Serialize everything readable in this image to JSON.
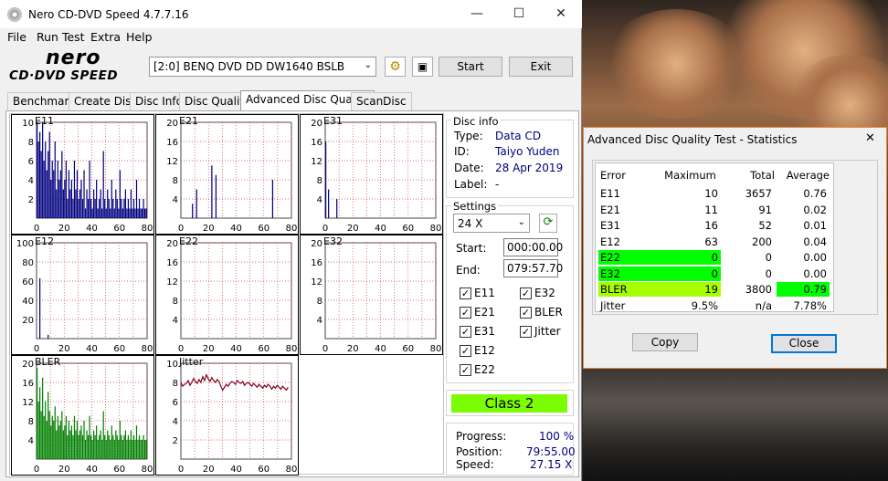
{
  "app": {
    "title": "Nero CD-DVD Speed 4.7.7.16",
    "logo_top": "nero",
    "logo_bottom": "CD·DVD SPEED"
  },
  "window_controls": {
    "minimize": "—",
    "maximize": "☐",
    "close": "✕"
  },
  "menu": [
    "File",
    "Run Test",
    "Extra",
    "Help"
  ],
  "toolbar": {
    "drive": "[2:0]   BENQ DVD DD DW1640 BSLB",
    "start": "Start",
    "exit": "Exit"
  },
  "tabs": [
    "Benchmark",
    "Create Disc",
    "Disc Info",
    "Disc Quality",
    "Advanced Disc Quality",
    "ScanDisc"
  ],
  "active_tab": "Advanced Disc Quality",
  "charts": [
    {
      "label": "E11",
      "yticks": [
        "10",
        "8",
        "6",
        "4",
        "2"
      ],
      "xticks": [
        "0",
        "20",
        "40",
        "60",
        "80"
      ]
    },
    {
      "label": "E21",
      "yticks": [
        "20",
        "16",
        "12",
        "8",
        "4"
      ],
      "xticks": [
        "0",
        "20",
        "40",
        "60",
        "80"
      ]
    },
    {
      "label": "E31",
      "yticks": [
        "20",
        "16",
        "12",
        "8",
        "4"
      ],
      "xticks": [
        "0",
        "20",
        "40",
        "60",
        "80"
      ]
    },
    {
      "label": "E12",
      "yticks": [
        "100",
        "80",
        "60",
        "40",
        "20"
      ],
      "xticks": [
        "0",
        "20",
        "40",
        "60",
        "80"
      ]
    },
    {
      "label": "E22",
      "yticks": [
        "20",
        "16",
        "12",
        "8",
        "4"
      ],
      "xticks": [
        "0",
        "20",
        "40",
        "60",
        "80"
      ]
    },
    {
      "label": "E32",
      "yticks": [
        "20",
        "16",
        "12",
        "8",
        "4"
      ],
      "xticks": [
        "0",
        "20",
        "40",
        "60",
        "80"
      ]
    },
    {
      "label": "BLER",
      "yticks": [
        "20",
        "16",
        "12",
        "8",
        "4"
      ],
      "xticks": [
        "0",
        "20",
        "40",
        "60",
        "80"
      ]
    },
    {
      "label": "Jitter",
      "yticks": [
        "10",
        "8",
        "6",
        "4",
        "2"
      ],
      "xticks": [
        "0",
        "20",
        "40",
        "60",
        "80"
      ]
    }
  ],
  "chart_data": [
    {
      "type": "bar",
      "title": "E11",
      "x": [
        0,
        80
      ],
      "ylim": [
        0,
        10
      ],
      "values": [
        10,
        8,
        9,
        7,
        10,
        6,
        8,
        5,
        7,
        9,
        4,
        6,
        5,
        8,
        3,
        6,
        4,
        5,
        7,
        3,
        4,
        6,
        2,
        5,
        3,
        4,
        2,
        6,
        3,
        5,
        2,
        3,
        4,
        2,
        5,
        1,
        3,
        2,
        6,
        2,
        1,
        3,
        2,
        4,
        1,
        2,
        3,
        1,
        7,
        2,
        1,
        3,
        2,
        1,
        4,
        2,
        1,
        3,
        2,
        1,
        5,
        2,
        1,
        2,
        3,
        1,
        2,
        1,
        3,
        1,
        2,
        1,
        4,
        1,
        2,
        1,
        1,
        2,
        1,
        1
      ]
    },
    {
      "type": "bar",
      "title": "E21",
      "x": [
        0,
        80
      ],
      "ylim": [
        0,
        20
      ],
      "values": [
        0,
        0,
        0,
        0,
        0,
        0,
        0,
        0,
        3,
        0,
        0,
        6,
        0,
        0,
        0,
        0,
        0,
        0,
        0,
        0,
        0,
        0,
        11,
        0,
        0,
        9,
        0,
        0,
        0,
        0,
        0,
        0,
        0,
        0,
        0,
        0,
        0,
        0,
        0,
        0,
        0,
        0,
        0,
        0,
        0,
        0,
        0,
        0,
        0,
        0,
        0,
        0,
        0,
        0,
        0,
        0,
        0,
        0,
        0,
        0,
        0,
        0,
        0,
        0,
        0,
        0,
        8,
        0,
        0,
        0,
        0,
        0,
        0,
        0,
        0,
        0,
        0,
        0,
        0,
        0
      ]
    },
    {
      "type": "bar",
      "title": "E31",
      "x": [
        0,
        80
      ],
      "ylim": [
        0,
        20
      ],
      "values": [
        16,
        0,
        6,
        0,
        0,
        0,
        0,
        0,
        4,
        0,
        0,
        0,
        0,
        0,
        0,
        0,
        0,
        0,
        0,
        0,
        0,
        0,
        0,
        0,
        0,
        0,
        0,
        0,
        0,
        0,
        0,
        0,
        0,
        0,
        0,
        0,
        0,
        0,
        0,
        0,
        0,
        0,
        0,
        0,
        0,
        0,
        0,
        0,
        0,
        0,
        0,
        0,
        0,
        0,
        0,
        0,
        0,
        0,
        0,
        0,
        0,
        0,
        0,
        0,
        0,
        0,
        0,
        0,
        0,
        0,
        0,
        0,
        0,
        0,
        0,
        0,
        0,
        0,
        0,
        0
      ]
    },
    {
      "type": "bar",
      "title": "E12",
      "x": [
        0,
        80
      ],
      "ylim": [
        0,
        100
      ],
      "values": [
        0,
        0,
        63,
        0,
        0,
        0,
        0,
        0,
        4,
        0,
        0,
        0,
        0,
        0,
        0,
        0,
        0,
        0,
        0,
        0,
        0,
        0,
        0,
        0,
        0,
        0,
        0,
        0,
        0,
        0,
        0,
        0,
        0,
        0,
        0,
        0,
        0,
        0,
        0,
        0,
        0,
        0,
        0,
        0,
        0,
        0,
        0,
        0,
        0,
        0,
        0,
        0,
        0,
        0,
        0,
        0,
        0,
        0,
        0,
        0,
        0,
        0,
        0,
        0,
        0,
        0,
        0,
        0,
        0,
        0,
        0,
        0,
        0,
        0,
        0,
        0,
        0,
        0,
        0,
        0
      ]
    },
    {
      "type": "bar",
      "title": "E22",
      "x": [
        0,
        80
      ],
      "ylim": [
        0,
        20
      ],
      "values": []
    },
    {
      "type": "bar",
      "title": "E32",
      "x": [
        0,
        80
      ],
      "ylim": [
        0,
        20
      ],
      "values": []
    },
    {
      "type": "bar",
      "title": "BLER",
      "x": [
        0,
        80
      ],
      "ylim": [
        0,
        20
      ],
      "values": [
        19,
        12,
        15,
        10,
        17,
        9,
        12,
        8,
        14,
        10,
        7,
        9,
        8,
        11,
        6,
        9,
        7,
        8,
        10,
        6,
        7,
        9,
        5,
        8,
        6,
        7,
        5,
        9,
        6,
        8,
        5,
        6,
        7,
        5,
        8,
        4,
        6,
        5,
        9,
        5,
        4,
        6,
        5,
        7,
        4,
        5,
        6,
        4,
        10,
        5,
        4,
        6,
        5,
        4,
        7,
        5,
        4,
        6,
        5,
        4,
        8,
        5,
        4,
        5,
        6,
        4,
        5,
        4,
        6,
        4,
        5,
        4,
        7,
        4,
        5,
        4,
        4,
        5,
        4,
        4
      ]
    },
    {
      "type": "line",
      "title": "Jitter",
      "x": [
        0,
        80
      ],
      "ylim": [
        0,
        10
      ],
      "values": [
        8.0,
        7.6,
        7.8,
        7.9,
        8.2,
        7.7,
        8.0,
        8.4,
        8.1,
        7.9,
        8.3,
        8.0,
        8.6,
        8.2,
        8.8,
        8.4,
        8.1,
        8.5,
        8.2,
        8.0,
        8.3,
        8.1,
        7.6,
        7.2,
        7.5,
        7.8,
        7.6,
        7.9,
        8.1,
        8.0,
        7.8,
        8.2,
        8.0,
        7.9,
        8.1,
        7.7,
        7.9,
        8.0,
        7.8,
        7.6,
        7.9,
        7.7,
        7.5,
        7.8,
        7.6,
        7.4,
        7.7,
        7.5,
        7.8,
        7.6,
        7.3,
        7.6,
        7.4,
        7.7,
        7.5,
        7.3,
        7.6,
        7.4,
        7.2,
        7.5
      ]
    }
  ],
  "disc_info": {
    "title": "Disc info",
    "type_label": "Type:",
    "type": "Data CD",
    "id_label": "ID:",
    "id": "Taiyo Yuden",
    "date_label": "Date:",
    "date": "28 Apr 2019",
    "label_label": "Label:",
    "label": "-"
  },
  "settings": {
    "title": "Settings",
    "speed": "24 X",
    "start_label": "Start:",
    "start": "000:00.00",
    "end_label": "End:",
    "end": "079:57.70",
    "checks": [
      {
        "label": "E11",
        "checked": true
      },
      {
        "label": "E32",
        "checked": true
      },
      {
        "label": "E21",
        "checked": true
      },
      {
        "label": "BLER",
        "checked": true
      },
      {
        "label": "E31",
        "checked": true
      },
      {
        "label": "Jitter",
        "checked": true
      },
      {
        "label": "E12",
        "checked": true
      },
      {
        "label": "E22",
        "checked": true
      }
    ]
  },
  "class_label": "Class 2",
  "progress": {
    "progress_label": "Progress:",
    "progress": "100 %",
    "position_label": "Position:",
    "position": "79:55.00",
    "speed_label": "Speed:",
    "speed": "27.15 X"
  },
  "stats": {
    "title": "Advanced Disc Quality Test - Statistics",
    "close_icon": "✕",
    "headers": [
      "Error",
      "Maximum",
      "Total",
      "Average"
    ],
    "rows": [
      [
        "E11",
        "10",
        "3657",
        "0.76"
      ],
      [
        "E21",
        "11",
        "91",
        "0.02"
      ],
      [
        "E31",
        "16",
        "52",
        "0.01"
      ],
      [
        "E12",
        "63",
        "200",
        "0.04"
      ],
      [
        "E22",
        "0",
        "0",
        "0.00"
      ],
      [
        "E32",
        "0",
        "0",
        "0.00"
      ],
      [
        "BLER",
        "19",
        "3800",
        "0.79"
      ],
      [
        "Jitter",
        "9.5%",
        "n/a",
        "7.78%"
      ]
    ],
    "copy": "Copy",
    "close": "Close"
  },
  "colors": {
    "bar": "#000080",
    "bler": "#008000",
    "jitter": "#800020",
    "class_bg": "#7cfc00",
    "highlight_green": "#00ff00",
    "highlight_yellow": "#a6ff00"
  }
}
